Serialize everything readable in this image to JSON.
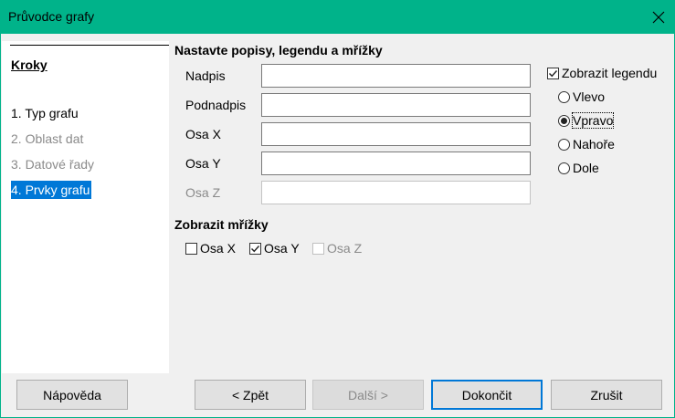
{
  "window": {
    "title": "Průvodce grafy"
  },
  "steps": {
    "heading": "Kroky",
    "items": [
      {
        "label": "1. Typ grafu",
        "state": "normal"
      },
      {
        "label": "2. Oblast dat",
        "state": "disabled"
      },
      {
        "label": "3. Datové řady",
        "state": "disabled"
      },
      {
        "label": "4. Prvky grafu",
        "state": "active"
      }
    ]
  },
  "titles": {
    "section": "Nastavte popisy, legendu a mřížky",
    "title_label": "Nadpis",
    "title_value": "",
    "subtitle_label": "Podnadpis",
    "subtitle_value": "",
    "x_label": "Osa X",
    "x_value": "",
    "y_label": "Osa Y",
    "y_value": "",
    "z_label": "Osa Z",
    "z_value": ""
  },
  "legend": {
    "show_label": "Zobrazit legendu",
    "show_checked": true,
    "left": "Vlevo",
    "right": "Vpravo",
    "top": "Nahoře",
    "bottom": "Dole",
    "selected": "Vpravo"
  },
  "grids": {
    "section": "Zobrazit mřížky",
    "x_label": "Osa X",
    "x_checked": false,
    "y_label": "Osa Y",
    "y_checked": true,
    "z_label": "Osa Z",
    "z_checked": false
  },
  "buttons": {
    "help": "Nápověda",
    "back": "< Zpět",
    "next": "Další >",
    "finish": "Dokončit",
    "cancel": "Zrušit"
  },
  "colors": {
    "titlebar": "#00b38a",
    "selection": "#0078d7"
  }
}
